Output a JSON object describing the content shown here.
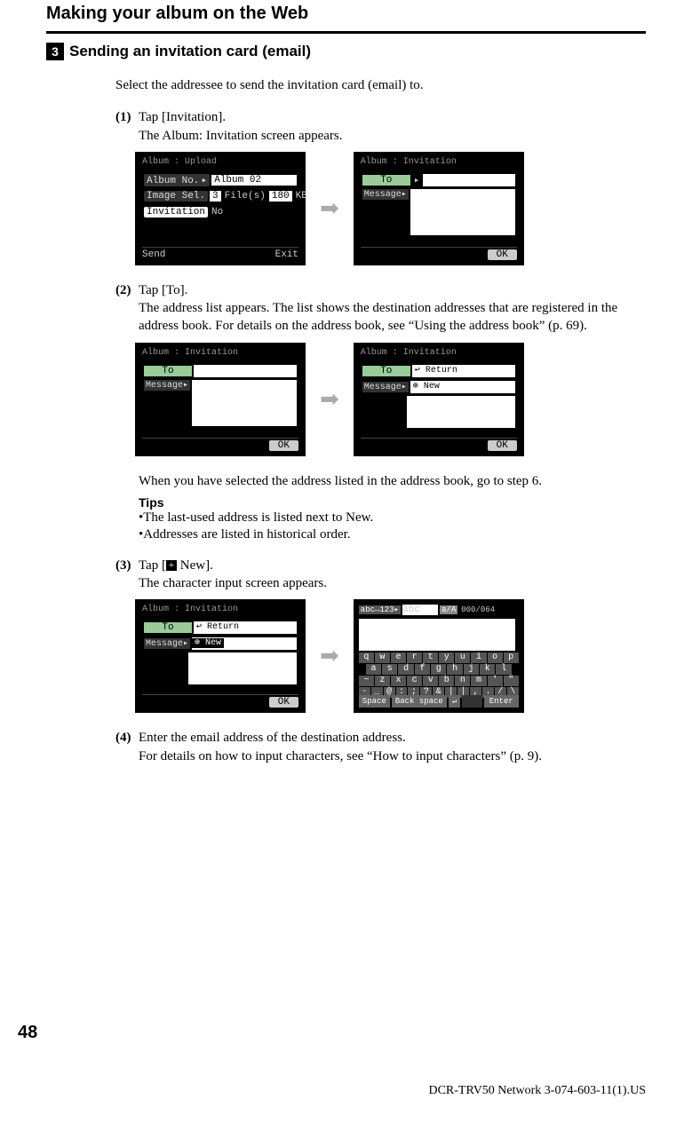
{
  "header": {
    "title": "Making your album on the Web"
  },
  "section": {
    "number": "3",
    "title": "Sending an invitation card (email)"
  },
  "intro": "Select the addressee to send the invitation card (email) to.",
  "steps": {
    "s1": {
      "label": "(1)",
      "line1": "Tap [Invitation].",
      "line2": "The Album: Invitation screen appears."
    },
    "s2": {
      "label": "(2)",
      "line1": "Tap [To].",
      "line2": "The address list appears. The list shows the destination addresses that are registered in the address book. For details on the address book, see “Using the address book” (p. 69).",
      "after": "When you have selected the address listed in the address book, go to step 6.",
      "tips_label": "Tips",
      "tip1": "•The last-used address is listed next to New.",
      "tip2": "•Addresses are listed in historical order."
    },
    "s3": {
      "label": "(3)",
      "line1a": "Tap [",
      "line1b": " New].",
      "line2": "The character input screen appears."
    },
    "s4": {
      "label": "(4)",
      "line1": "Enter the email address of the destination address.",
      "line2": "For details on how to input characters, see “How to input characters” (p. 9)."
    }
  },
  "device": {
    "upload": {
      "title": "Album : Upload",
      "row1_label": "Album No. ▸",
      "row1_val": "Album 02",
      "row2_label": "Image Sel.",
      "row2_count": "3",
      "row2_files": "File(s)",
      "row2_size": "180",
      "row2_kb": "KB",
      "row3_label": "Invitation",
      "row3_val": "No",
      "send": "Send",
      "exit": "Exit"
    },
    "invitation": {
      "title": "Album : Invitation",
      "to": "To",
      "to_marker": "▸",
      "message": "Message▸",
      "ok": "OK",
      "return": "↩ Return",
      "new": "⊕ New"
    },
    "keyboard": {
      "mode": "abc↔123▸",
      "abc": "abc",
      "aA": "a/A",
      "count": "000/064",
      "rows": [
        [
          "q",
          "w",
          "e",
          "r",
          "t",
          "y",
          "u",
          "i",
          "o",
          "p"
        ],
        [
          "a",
          "s",
          "d",
          "f",
          "g",
          "h",
          "j",
          "k",
          "l"
        ],
        [
          "~",
          "z",
          "x",
          "c",
          "v",
          "b",
          "n",
          "m",
          "'",
          "\""
        ],
        [
          "-",
          "_",
          "@",
          ":",
          ";",
          "?",
          "&",
          "|",
          "|",
          ",",
          ".",
          "/",
          "\\"
        ]
      ],
      "space": "Space",
      "back": "Back space",
      "enter": "Enter",
      "ret": "↵"
    }
  },
  "page_number": "48",
  "footer": "DCR-TRV50 Network 3-074-603-11(1).US"
}
